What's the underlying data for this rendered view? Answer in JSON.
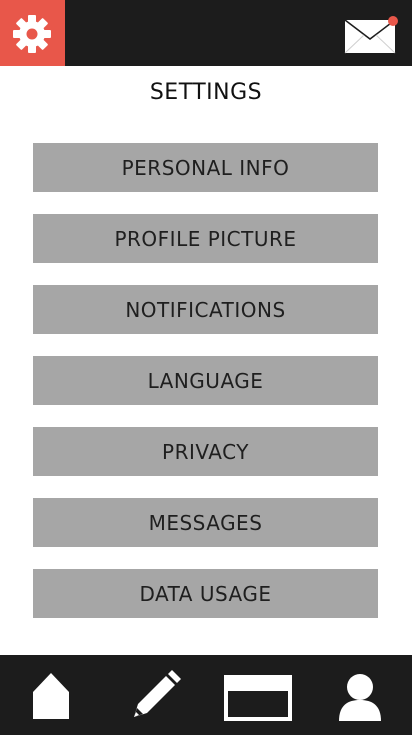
{
  "header": {
    "settings_icon": "gear-icon",
    "mail_icon": "envelope-icon",
    "mail_has_notification": true
  },
  "page": {
    "title": "SETTINGS"
  },
  "menu": {
    "items": [
      {
        "label": "PERSONAL INFO"
      },
      {
        "label": "PROFILE PICTURE"
      },
      {
        "label": "NOTIFICATIONS"
      },
      {
        "label": "LANGUAGE"
      },
      {
        "label": "PRIVACY"
      },
      {
        "label": "MESSAGES"
      },
      {
        "label": "DATA USAGE"
      }
    ]
  },
  "bottom_nav": {
    "items": [
      {
        "icon": "home-icon"
      },
      {
        "icon": "pencil-icon"
      },
      {
        "icon": "window-icon"
      },
      {
        "icon": "user-icon"
      }
    ]
  },
  "colors": {
    "bar_background": "#1c1c1c",
    "accent": "#e8574a",
    "button_gray": "#a6a6a6",
    "notification_dot": "#e8574a"
  }
}
